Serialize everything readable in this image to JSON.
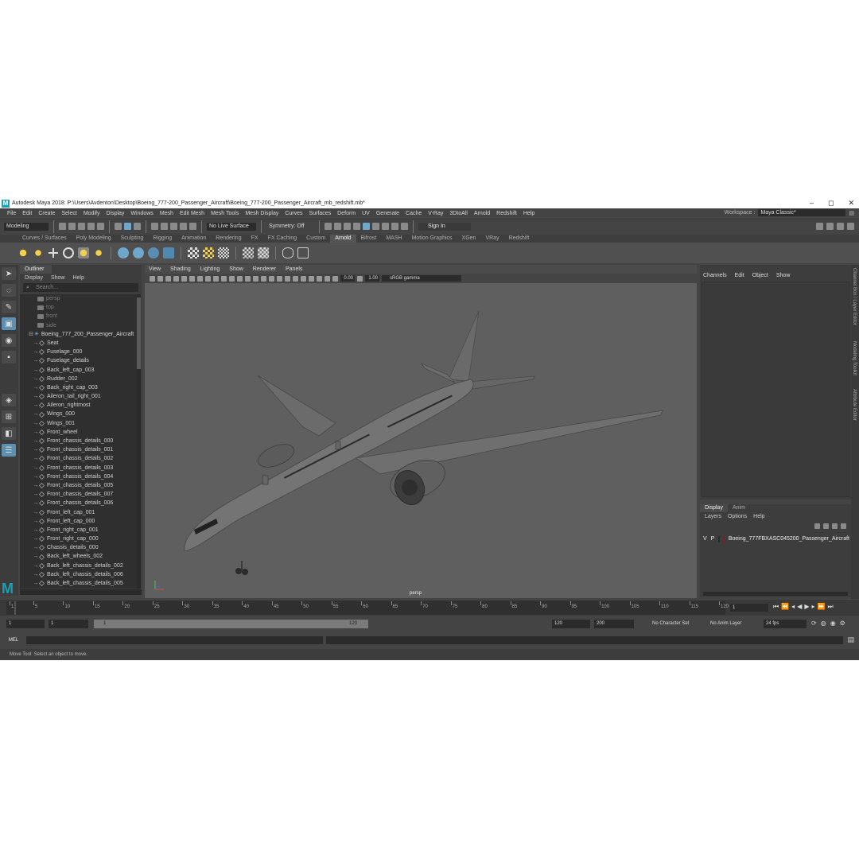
{
  "window": {
    "title": "Autodesk Maya 2018: P:\\Users\\Avdenton\\Desktop\\Boeing_777-200_Passenger_Aircraft\\Boeing_777-200_Passenger_Aircraft_mb_redshift.mb*",
    "minimize": "–",
    "maximize": "◻",
    "close": "✕"
  },
  "menu": [
    "File",
    "Edit",
    "Create",
    "Select",
    "Modify",
    "Display",
    "Windows",
    "Mesh",
    "Edit Mesh",
    "Mesh Tools",
    "Mesh Display",
    "Curves",
    "Surfaces",
    "Deform",
    "UV",
    "Generate",
    "Cache",
    "V-Ray",
    "3DtoAll",
    "Arnold",
    "Redshift",
    "Help"
  ],
  "workspace": {
    "label": "Workspace :",
    "value": "Maya Classic*"
  },
  "status": {
    "mode": "Modeling",
    "live_surface": "No Live Surface",
    "symmetry": "Symmetry: Off",
    "sign_in": "Sign In"
  },
  "shelf_tabs": [
    {
      "label": "Curves / Surfaces",
      "active": false
    },
    {
      "label": "Poly Modeling",
      "active": false
    },
    {
      "label": "Sculpting",
      "active": false
    },
    {
      "label": "Rigging",
      "active": false
    },
    {
      "label": "Animation",
      "active": false
    },
    {
      "label": "Rendering",
      "active": false
    },
    {
      "label": "FX",
      "active": false
    },
    {
      "label": "FX Caching",
      "active": false
    },
    {
      "label": "Custom",
      "active": false
    },
    {
      "label": "Arnold",
      "active": true
    },
    {
      "label": "Bifrost",
      "active": false
    },
    {
      "label": "MASH",
      "active": false
    },
    {
      "label": "Motion Graphics",
      "active": false
    },
    {
      "label": "XGen",
      "active": false
    },
    {
      "label": "VRay",
      "active": false
    },
    {
      "label": "Redshift",
      "active": false
    }
  ],
  "outliner": {
    "tab": "Outliner",
    "menu": [
      "Display",
      "Show",
      "Help"
    ],
    "search_placeholder": "Search...",
    "cameras": [
      "persp",
      "top",
      "front",
      "side"
    ],
    "group": "Boeing_777_200_Passenger_Aircraft",
    "children": [
      "Seat",
      "Fuselage_000",
      "Fuselage_details",
      "Back_left_cap_003",
      "Rudder_002",
      "Back_right_cap_003",
      "Aileron_tail_right_001",
      "Aileron_rightmost",
      "Wings_000",
      "Wings_001",
      "Front_wheel",
      "Front_chassis_details_000",
      "Front_chassis_details_001",
      "Front_chassis_details_002",
      "Front_chassis_details_003",
      "Front_chassis_details_004",
      "Front_chassis_details_005",
      "Front_chassis_details_007",
      "Front_chassis_details_006",
      "Front_left_cap_001",
      "Front_left_cap_000",
      "Front_right_cap_001",
      "Front_right_cap_000",
      "Chassis_details_000",
      "Back_left_wheels_002",
      "Back_left_chassis_details_002",
      "Back_left_chassis_details_006",
      "Back_left_chassis_details_005"
    ]
  },
  "viewport": {
    "menu": [
      "View",
      "Shading",
      "Lighting",
      "Show",
      "Renderer",
      "Panels"
    ],
    "exposure": "0.00",
    "gamma": "1.00",
    "color_space": "sRGB gamma",
    "camera": "persp"
  },
  "channel_box": {
    "menu": [
      "Channels",
      "Edit",
      "Object",
      "Show"
    ],
    "side_tabs": [
      "Channel Box / Layer Editor",
      "Modeling Toolkit",
      "Attribute Editor"
    ]
  },
  "layers": {
    "tabs": [
      "Display",
      "Anim"
    ],
    "menu": [
      "Layers",
      "Options",
      "Help"
    ],
    "layer": {
      "v": "V",
      "p": "P",
      "name": "Boeing_777FBXASC045200_Passenger_Aircraft",
      "color": "#8a1a2a"
    }
  },
  "time_slider": {
    "ticks": [
      "1",
      "5",
      "10",
      "15",
      "20",
      "25",
      "30",
      "35",
      "40",
      "45",
      "50",
      "55",
      "60",
      "65",
      "70",
      "75",
      "80",
      "85",
      "90",
      "95",
      "100",
      "105",
      "110",
      "115",
      "120"
    ],
    "current_frame": "1"
  },
  "range": {
    "start": "1",
    "playback_start": "1",
    "bar_start": "1",
    "bar_end": "120",
    "playback_end": "120",
    "end": "200",
    "character_set": "No Character Set",
    "anim_layer": "No Anim Layer",
    "fps": "24 fps"
  },
  "command": {
    "label": "MEL"
  },
  "help_line": "Move Tool: Select an object to move."
}
